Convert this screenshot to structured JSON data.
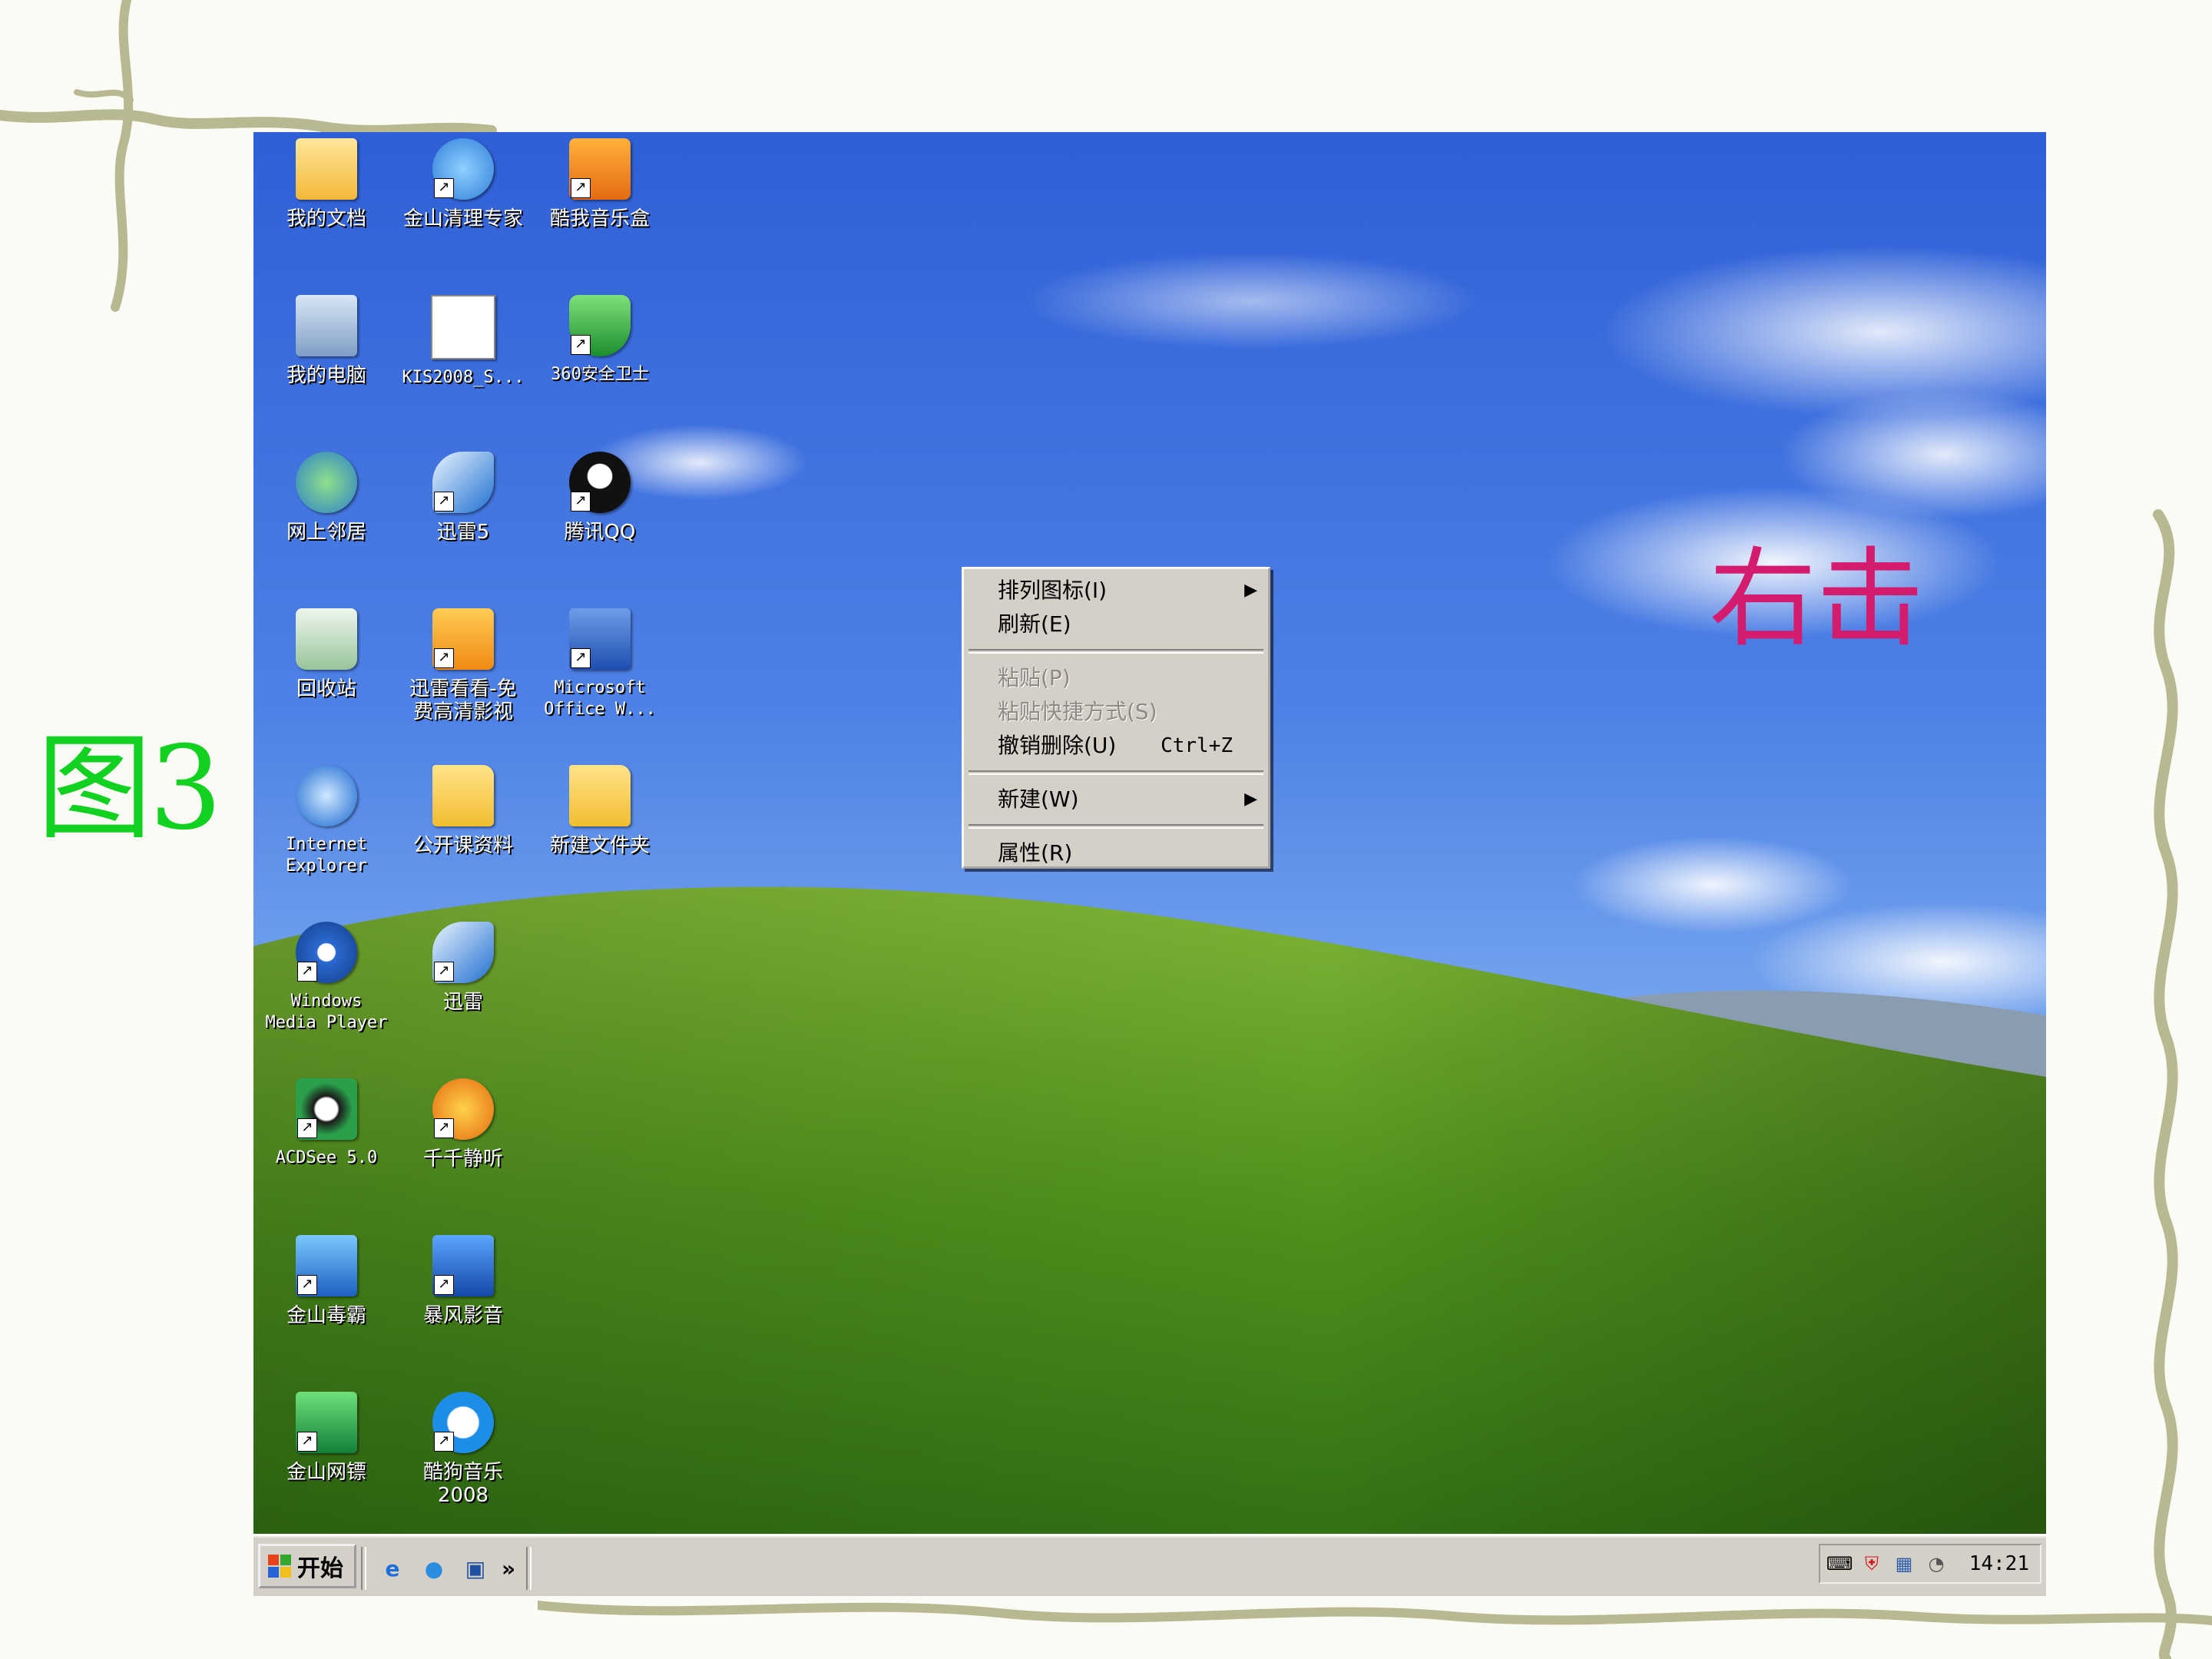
{
  "slide": {
    "figure_label": "图3",
    "annotation": "右击"
  },
  "desktop_icons": [
    {
      "label": "我的文档",
      "icon": "my-documents-icon"
    },
    {
      "label": "金山清理专家",
      "icon": "cleaner-icon",
      "shortcut": true
    },
    {
      "label": "酷我音乐盒",
      "icon": "music-box-icon",
      "shortcut": true
    },
    {
      "label": "我的电脑",
      "icon": "my-computer-icon"
    },
    {
      "label": "KIS2008_S...",
      "icon": "text-file-icon"
    },
    {
      "label": "360安全卫士",
      "icon": "shield-icon",
      "shortcut": true
    },
    {
      "label": "网上邻居",
      "icon": "network-places-icon"
    },
    {
      "label": "迅雷5",
      "icon": "thunder-icon",
      "shortcut": true
    },
    {
      "label": "腾讯QQ",
      "icon": "qq-penguin-icon",
      "shortcut": true
    },
    {
      "label": "回收站",
      "icon": "recycle-bin-icon"
    },
    {
      "label": "迅雷看看-免\n费高清影视",
      "icon": "xunlei-kankan-icon",
      "shortcut": true
    },
    {
      "label": "Microsoft\nOffice W...",
      "icon": "word-icon",
      "shortcut": true
    },
    {
      "label": "Internet\nExplorer",
      "icon": "internet-explorer-icon"
    },
    {
      "label": "公开课资料",
      "icon": "folder-icon"
    },
    {
      "label": "新建文件夹",
      "icon": "folder-icon"
    },
    {
      "label": "Windows\nMedia Player",
      "icon": "media-player-icon",
      "shortcut": true
    },
    {
      "label": "迅雷",
      "icon": "thunder-icon",
      "shortcut": true
    },
    {
      "label": "ACDSee 5.0",
      "icon": "acdsee-eye-icon",
      "shortcut": true
    },
    {
      "label": "千千静听",
      "icon": "headphones-icon",
      "shortcut": true
    },
    {
      "label": "金山毒霸",
      "icon": "antivirus-icon",
      "shortcut": true
    },
    {
      "label": "暴风影音",
      "icon": "video-player-icon",
      "shortcut": true
    },
    {
      "label": "金山网镖",
      "icon": "firewall-icon",
      "shortcut": true
    },
    {
      "label": "酷狗音乐2008",
      "icon": "kugou-icon",
      "shortcut": true
    }
  ],
  "context_menu": {
    "items": [
      {
        "label": "排列图标(I)",
        "submenu": true,
        "disabled": false
      },
      {
        "label": "刷新(E)",
        "disabled": false
      },
      {
        "label": "粘贴(P)",
        "disabled": true
      },
      {
        "label": "粘贴快捷方式(S)",
        "disabled": true
      },
      {
        "label": "撤销删除(U)",
        "shortcut": "Ctrl+Z",
        "disabled": false
      },
      {
        "label": "新建(W)",
        "submenu": true,
        "disabled": false
      },
      {
        "label": "属性(R)",
        "disabled": false
      }
    ]
  },
  "taskbar": {
    "start_label": "开始",
    "quick_launch": [
      "ie-icon",
      "messenger-icon",
      "desktop-icon"
    ],
    "more": "»",
    "clock": "14:21"
  },
  "colors": {
    "annotation": "#d31c6d",
    "figure_label": "#12d121",
    "taskbar": "#d4d0c8"
  }
}
